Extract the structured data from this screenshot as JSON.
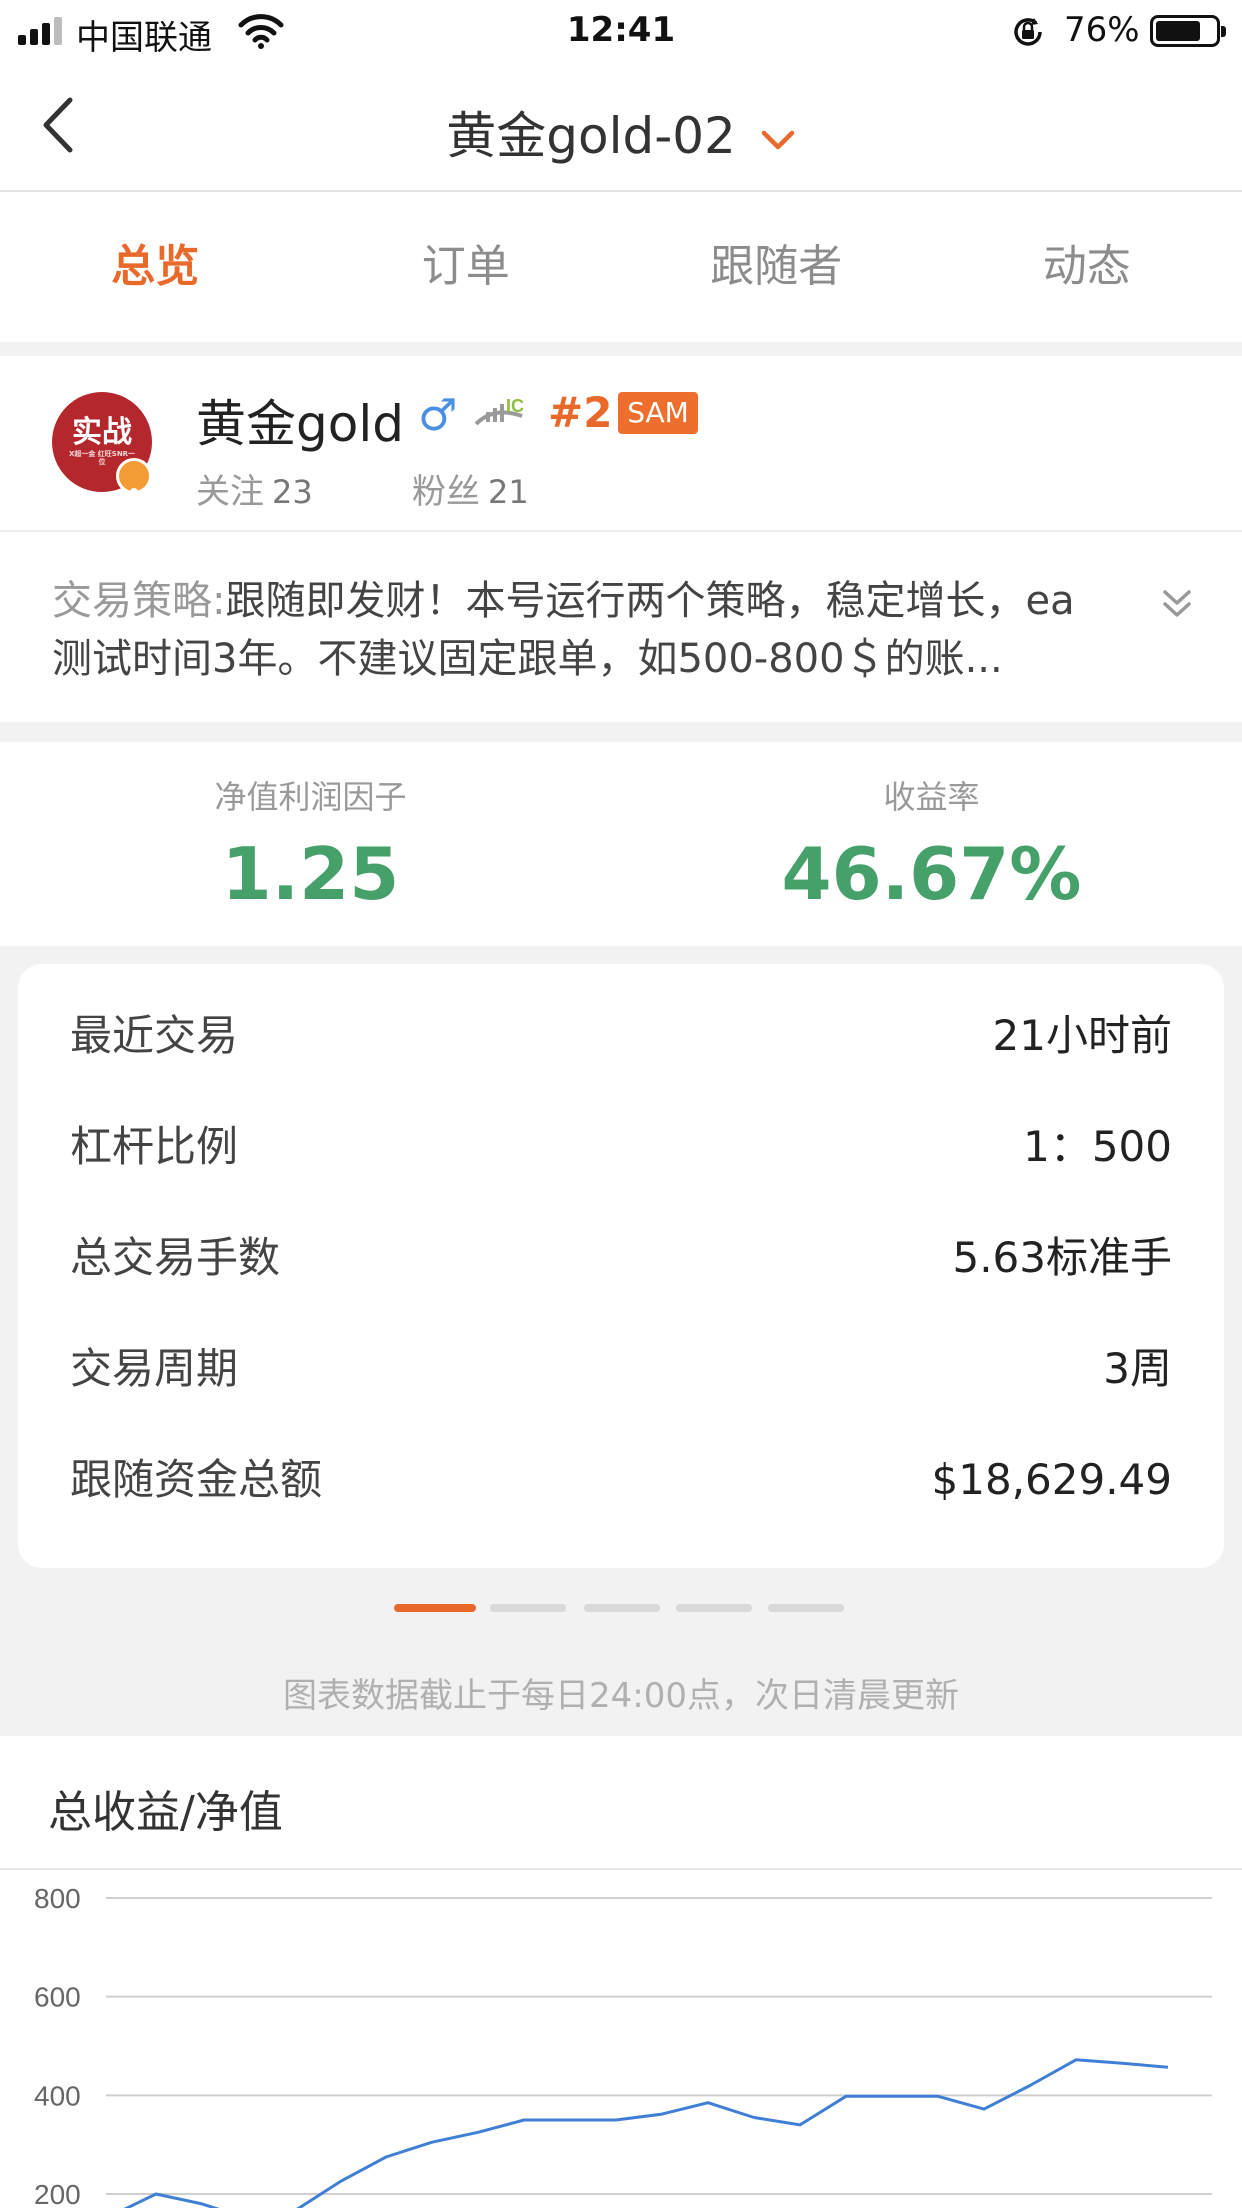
{
  "status_bar": {
    "carrier": "中国联通",
    "time": "12:41",
    "battery_percent": "76%",
    "battery_level": 0.76,
    "signal_bars": 4
  },
  "nav": {
    "title": "黄金gold-02",
    "back_icon": "chevron-left-icon",
    "dropdown_icon": "chevron-down-icon"
  },
  "tabs": [
    {
      "label": "总览",
      "active": true
    },
    {
      "label": "订单",
      "active": false
    },
    {
      "label": "跟随者",
      "active": false
    },
    {
      "label": "动态",
      "active": false
    }
  ],
  "profile": {
    "avatar_text": "实战",
    "avatar_subtext": "X超一金 红旺SNR一位",
    "name": "黄金gold",
    "gender_icon": "♂",
    "rank": "#2",
    "badge": "SAM",
    "following_label": "关注",
    "following_count": "23",
    "fans_label": "粉丝",
    "fans_count": "21"
  },
  "strategy": {
    "label": "交易策略:",
    "text": "跟随即发财！本号运行两个策略，稳定增长，ea测试时间3年。不建议固定跟单，如500-800＄的账..."
  },
  "metrics": [
    {
      "label": "净值利润因子",
      "value": "1.25"
    },
    {
      "label": "收益率",
      "value": "46.67%"
    }
  ],
  "info": [
    {
      "key": "最近交易",
      "value": "21小时前"
    },
    {
      "key": "杠杆比例",
      "value": "1：500"
    },
    {
      "key": "总交易手数",
      "value": "5.63标准手"
    },
    {
      "key": "交易周期",
      "value": "3周"
    },
    {
      "key": "跟随资金总额",
      "value": "$18,629.49"
    }
  ],
  "pager": {
    "count": 5,
    "active_index": 0
  },
  "note": "图表数据截止于每日24:00点，次日清晨更新",
  "chart_header": {
    "title": "总收益/净值"
  },
  "colors": {
    "accent": "#e8692a",
    "positive": "#46a06a",
    "line": "#3f7fd6"
  },
  "chart_data": {
    "type": "line",
    "title": "",
    "xlabel": "",
    "ylabel": "",
    "yticks": [
      200,
      400,
      600,
      800
    ],
    "ylim": [
      200,
      800
    ],
    "grid": true,
    "series": [
      {
        "values": [
          155,
          200,
          180,
          150,
          165,
          225,
          275,
          305,
          325,
          350,
          350,
          350,
          362,
          385,
          355,
          340,
          398,
          398,
          398,
          372,
          420,
          472,
          465,
          457
        ]
      }
    ]
  }
}
